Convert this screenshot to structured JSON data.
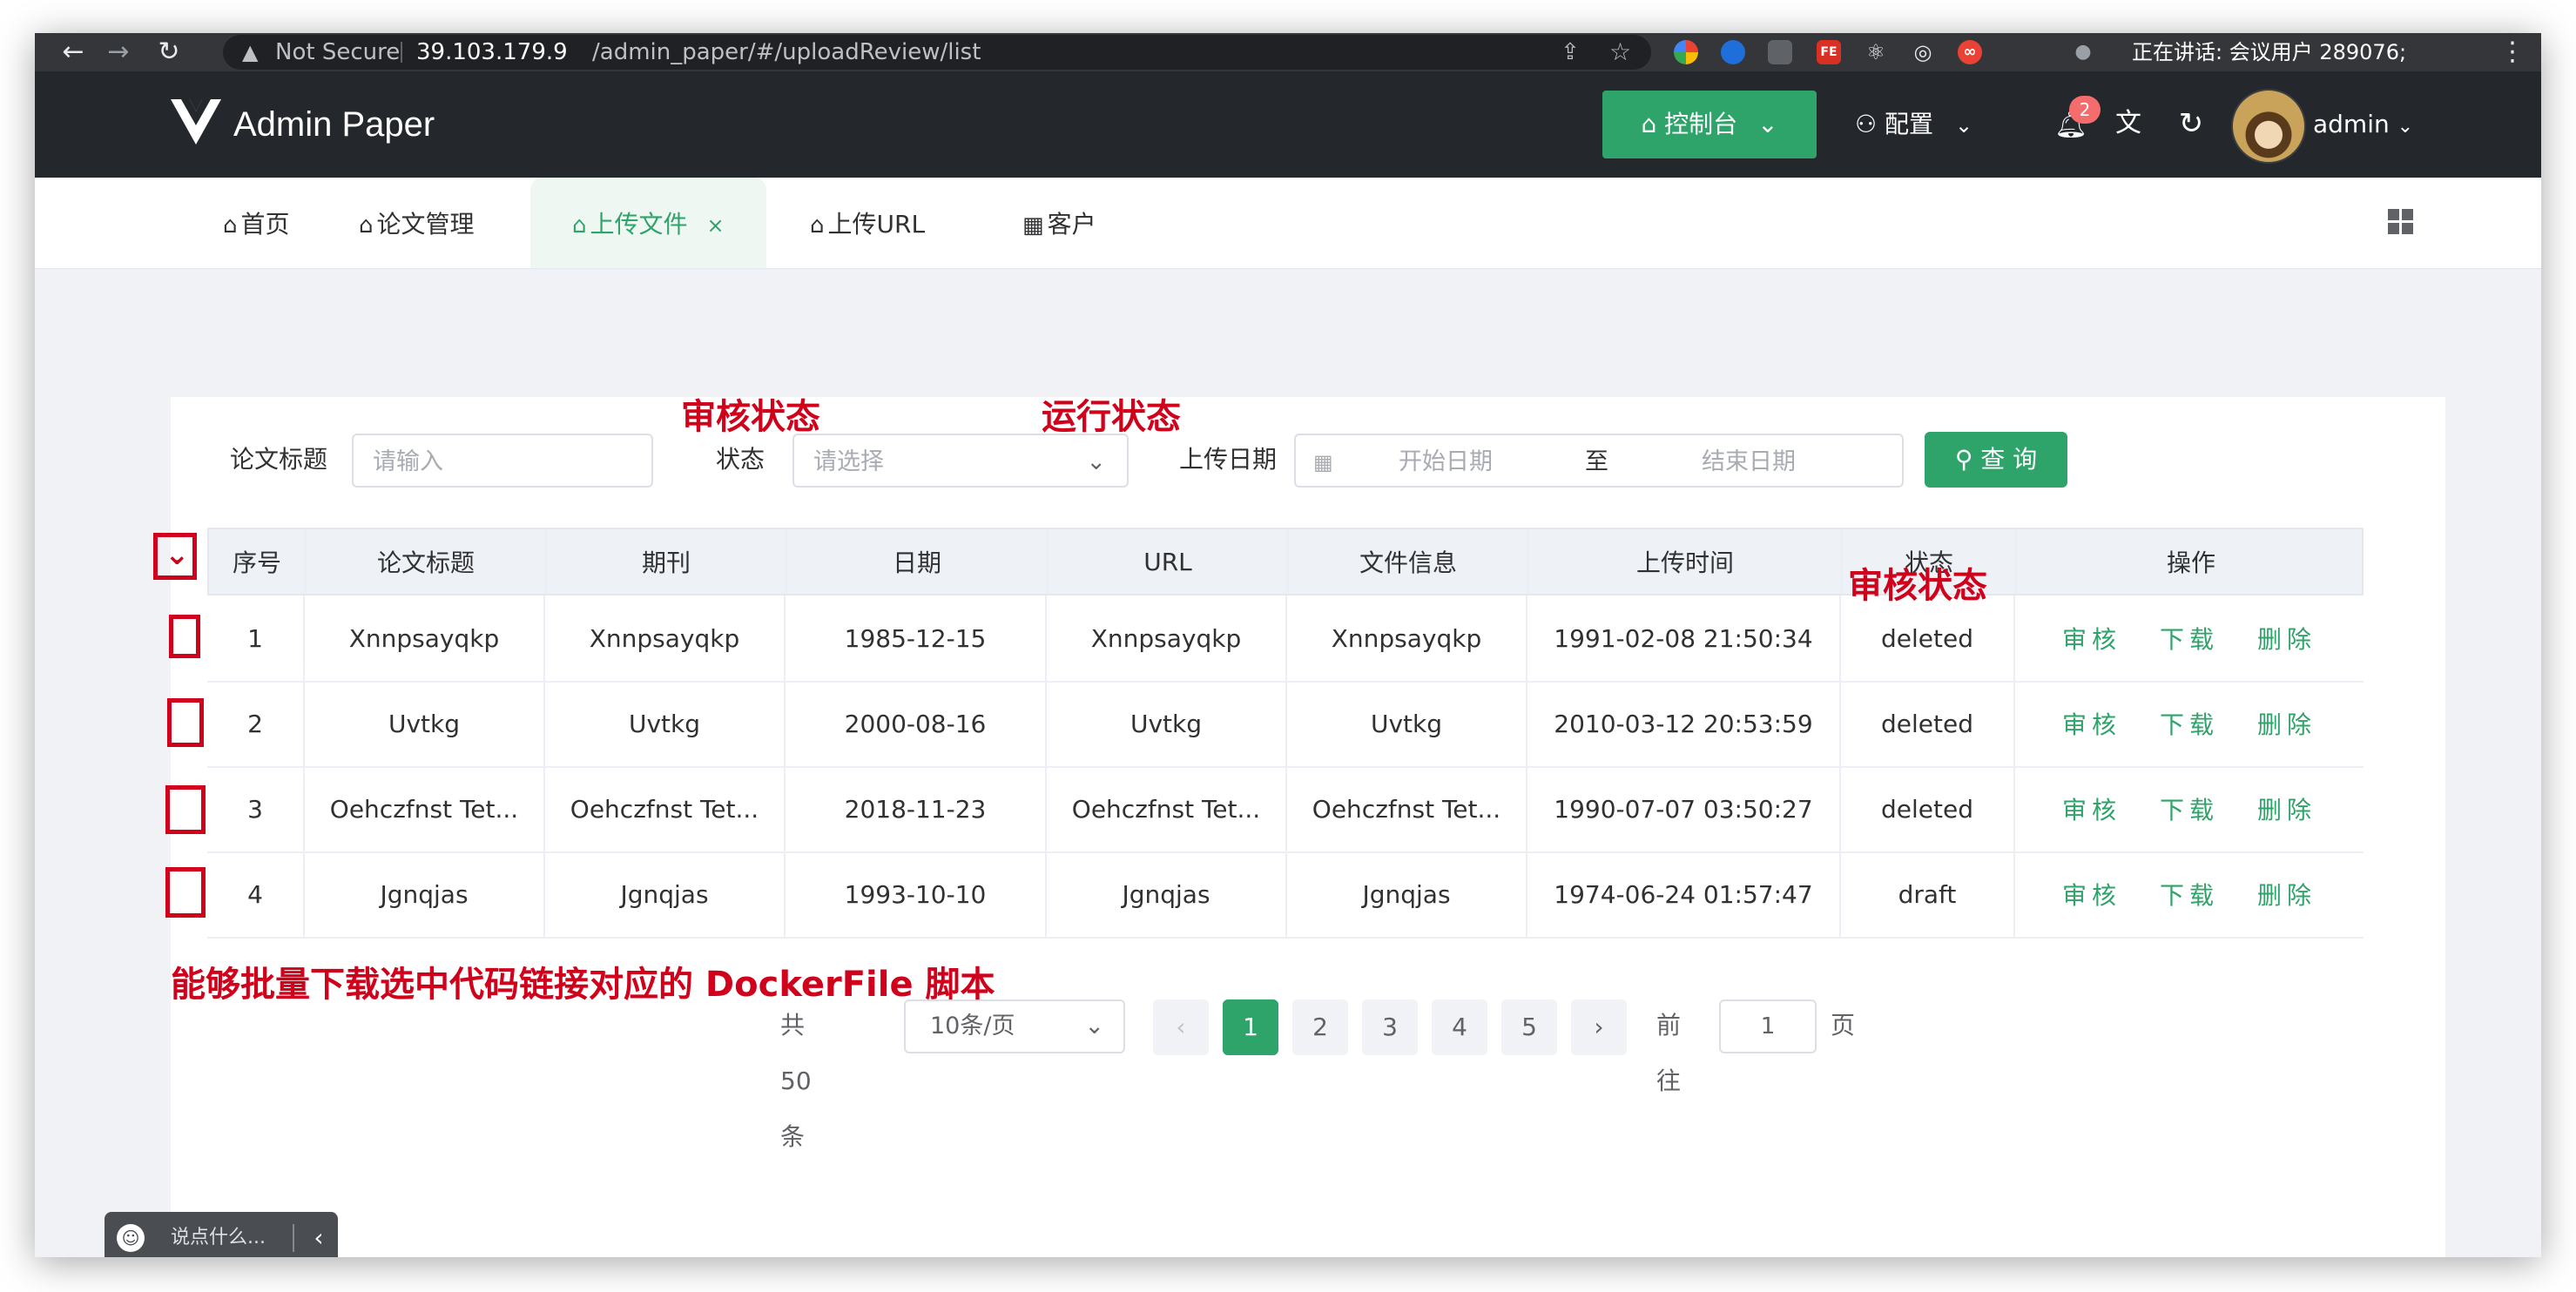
{
  "browser": {
    "security_label": "Not Secure",
    "url_host": "39.103.179.9",
    "url_path": "/admin_paper/#/uploadReview/list",
    "speaking_text": "正在讲话: 会议用户 289076;"
  },
  "header": {
    "brand": "Admin Paper",
    "console_label": "控制台",
    "config_label": "配置",
    "notification_count": "2",
    "username": "admin"
  },
  "tabs": [
    {
      "label": "首页",
      "icon": "home-icon"
    },
    {
      "label": "论文管理",
      "icon": "home-icon"
    },
    {
      "label": "上传文件",
      "icon": "home-icon",
      "active": true
    },
    {
      "label": "上传URL",
      "icon": "home-icon"
    },
    {
      "label": "客户",
      "icon": "grid-icon"
    }
  ],
  "filters": {
    "title_label": "论文标题",
    "title_placeholder": "请输入",
    "status_label": "状态",
    "status_placeholder": "请选择",
    "date_label": "上传日期",
    "date_start_placeholder": "开始日期",
    "date_separator": "至",
    "date_end_placeholder": "结束日期",
    "query_label": "查 询"
  },
  "table": {
    "columns": [
      "序号",
      "论文标题",
      "期刊",
      "日期",
      "URL",
      "文件信息",
      "上传时间",
      "状态",
      "操作"
    ],
    "rows": [
      {
        "no": "1",
        "title": "Xnnpsayqkp",
        "journal": "Xnnpsayqkp",
        "date": "1985-12-15",
        "url": "Xnnpsayqkp",
        "file_info": "Xnnpsayqkp",
        "upload_time": "1991-02-08 21:50:34",
        "status": "deleted"
      },
      {
        "no": "2",
        "title": "Uvtkg",
        "journal": "Uvtkg",
        "date": "2000-08-16",
        "url": "Uvtkg",
        "file_info": "Uvtkg",
        "upload_time": "2010-03-12 20:53:59",
        "status": "deleted"
      },
      {
        "no": "3",
        "title": "Oehczfnst Tet...",
        "journal": "Oehczfnst Tet...",
        "date": "2018-11-23",
        "url": "Oehczfnst Tet...",
        "file_info": "Oehczfnst Tet...",
        "upload_time": "1990-07-07 03:50:27",
        "status": "deleted"
      },
      {
        "no": "4",
        "title": "Jgnqjas",
        "journal": "Jgnqjas",
        "date": "1993-10-10",
        "url": "Jgnqjas",
        "file_info": "Jgnqjas",
        "upload_time": "1974-06-24 01:57:47",
        "status": "draft"
      }
    ],
    "actions": {
      "review": "审核",
      "download": "下载",
      "delete": "删除"
    }
  },
  "pagination": {
    "total": "共 50 条",
    "page_size": "10条/页",
    "pages": [
      "1",
      "2",
      "3",
      "4",
      "5"
    ],
    "current": "1",
    "goto_label": "前往",
    "goto_value": "1",
    "page_suffix": "页"
  },
  "annotations": {
    "review_status": "审核状态",
    "run_status": "运行状态",
    "review_status_column": "审核状态",
    "batch_note": "能够批量下载选中代码链接对应的 DockerFile 脚本"
  },
  "chat": {
    "placeholder": "说点什么..."
  },
  "colors": {
    "primary": "#2ea36a",
    "header_bg": "#24272c",
    "annotation": "#d0021b",
    "badge": "#f56c6c"
  }
}
